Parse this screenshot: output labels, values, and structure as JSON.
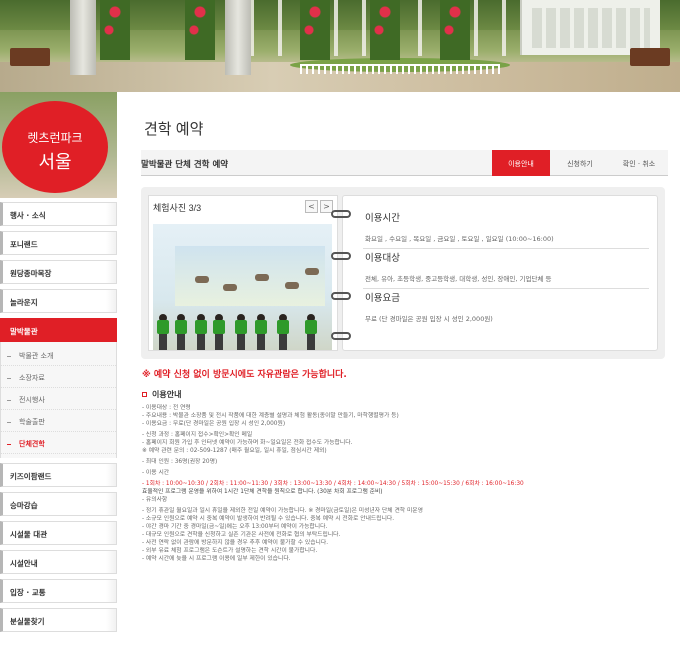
{
  "logo": {
    "subtitle": "렛츠런파크",
    "title": "서울"
  },
  "menu": {
    "items_top": [
      "행사 · 소식",
      "포니랜드",
      "원당종마목장",
      "놀라운지"
    ],
    "active": "말박물관",
    "sub_items": [
      "박물관 소개",
      "소장자료",
      "전시행사",
      "학술출판",
      "단체견학"
    ],
    "sub_current_index": 4,
    "items_bottom": [
      "키즈이팜랜드",
      "승마강습",
      "시설물 대관",
      "시설안내",
      "입장 · 교통",
      "분실물찾기"
    ]
  },
  "page": {
    "title": "견학 예약",
    "subtitle": "말박물관 단체 견학 예약",
    "tabs": [
      "이용안내",
      "신청하기",
      "확인 · 취소"
    ],
    "active_tab": 0
  },
  "gallery": {
    "title": "체험사진 3/3",
    "prev": "<",
    "next": ">"
  },
  "info": [
    {
      "heading": "이용시간",
      "detail": "화요일 , 수요일 , 목요일 , 금요일 , 토요일 , 일요일 (10:00~16:00)"
    },
    {
      "heading": "이용대상",
      "detail": "전체, 유아, 초등학생, 중고등학생, 대학생, 성인, 장애인, 기업단체 등"
    },
    {
      "heading": "이용요금",
      "detail": "무료 (단 경마일은 공원 입장 시 성인 2,000원)"
    }
  ],
  "notice": "※ 예약 신청 없이 방문시에도 자유관람은 가능합니다.",
  "guide": {
    "heading": "이용안내",
    "lines": [
      {
        "text": "- 이용대상 : 전 연령",
        "style": ""
      },
      {
        "text": "- 주요내용 : 박물관 소장품 및 전시 작품에 대한 계층별 설명과 체험 활동(종이말 만들기, 마학행렬평가 등)",
        "style": ""
      },
      {
        "text": "- 이용요금 : 무료(단 경마일은 공원 입장 시 성인 2,000원)",
        "style": ""
      },
      {
        "text": "",
        "style": "gap"
      },
      {
        "text": "- 신청 과정 : 홈페이지 접수>확인>확인 메일",
        "style": ""
      },
      {
        "text": "   - 홈페이지 회원 가입 후 인터넷 예약이 가능하며 화~일요일은 전화 접수도 가능합니다.",
        "style": ""
      },
      {
        "text": "   ※ 예약 관련 문의 : 02-509-1287 (매주 월요일, 일시 휴일, 점심시간 제외)",
        "style": ""
      },
      {
        "text": "",
        "style": "gap"
      },
      {
        "text": "- 최대 인원 : 36명(권장 20명)",
        "style": ""
      },
      {
        "text": "",
        "style": "gap"
      },
      {
        "text": "- 이용 시간",
        "style": ""
      },
      {
        "text": "",
        "style": "gap"
      },
      {
        "text": "- 1회차 : 10:00~10:30 / 2회차 : 11:00~11:30 / 3회차 : 13:00~13:30 / 4회차 : 14:00~14:30 / 5회차 : 15:00~15:30 / 6회차 : 16:00~16:30",
        "style": "red"
      },
      {
        "text": "효율적인 프로그램 운영을 위하여 1시간 1단체 견학을 원칙으로 합니다. (30분 차회 프로그램 준비)",
        "style": "dark"
      },
      {
        "text": "- 유의사항",
        "style": ""
      },
      {
        "text": "",
        "style": "gap"
      },
      {
        "text": "- 정기 휴관일 월요일과 일시 휴일을 제외한 전일 예약이 가능합니다. ※ 경마일(금토일)은 미성년자 단체 견학 미운영",
        "style": ""
      },
      {
        "text": "- 소규모 인원으로 예약 시 중복 예약이 발생하여 반려될 수 있습니다. 중복 예약 시 전화로 안내드립니다.",
        "style": ""
      },
      {
        "text": "- 야간 경마 기간 중 경마일(금~일)에는 오후 13:00부터 예약이 가능합니다.",
        "style": ""
      },
      {
        "text": "- 대규모 인원으로 견학을 신청하고 실존 기관은 사전에 전화로 협의 부탁드립니다.",
        "style": ""
      },
      {
        "text": "- 사전 연락 없이 관람에 방문하지 않을 경우 추후 예약이 불가할 수 있습니다.",
        "style": ""
      },
      {
        "text": "- 외부 유료 체험 프로그램은 도슨트가 설명하는 견학 시간이 불가합니다.",
        "style": ""
      },
      {
        "text": "- 예약 시간에 늦을 시 프로그램 이용에 일부 제한이 있습니다.",
        "style": ""
      }
    ]
  },
  "colors": {
    "accent": "#e01f26"
  }
}
